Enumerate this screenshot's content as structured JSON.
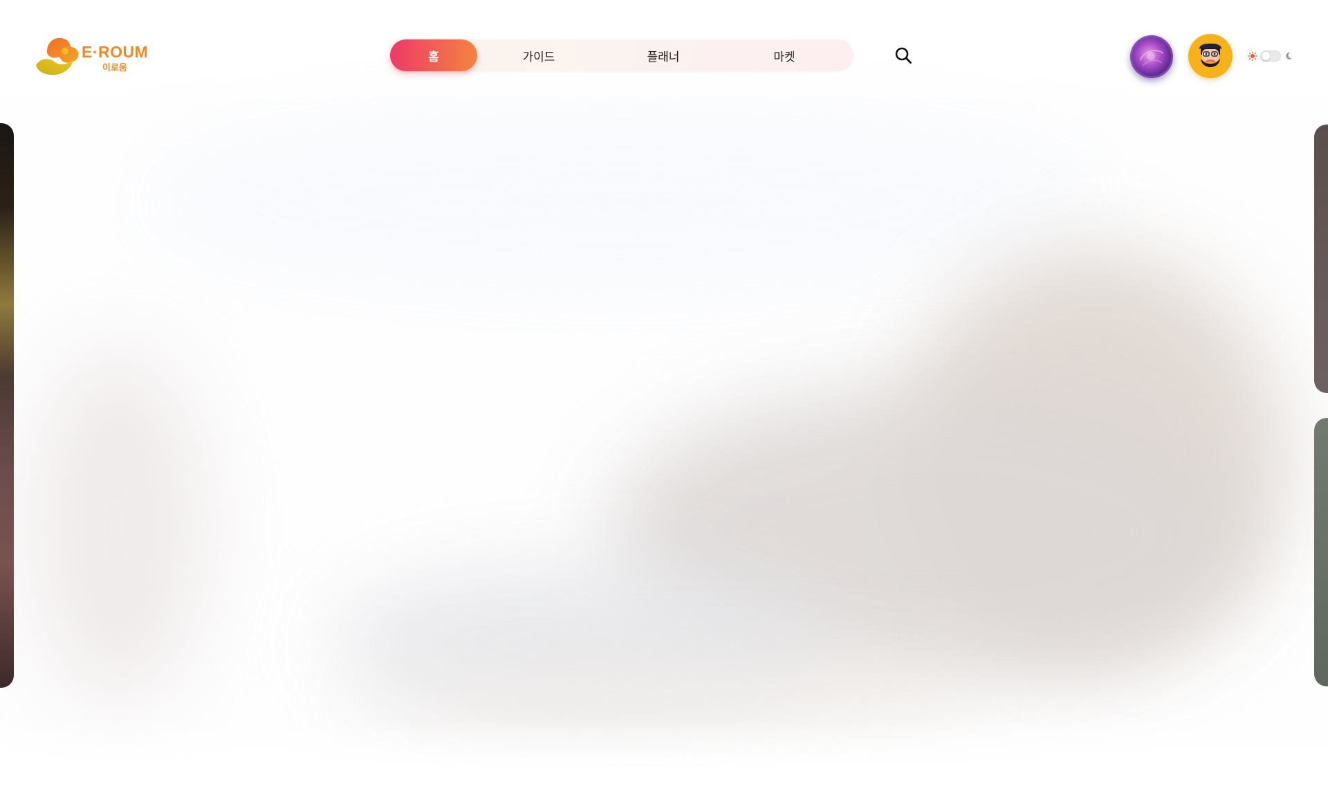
{
  "brand": {
    "name": "E·ROUM",
    "name_ko": "이로움",
    "colors": {
      "primary": "#f08a22",
      "accent_start": "#ee3a68",
      "accent_end": "#f5833f"
    }
  },
  "nav": {
    "tabs": [
      {
        "label": "홈",
        "active": true
      },
      {
        "label": "가이드",
        "active": false
      },
      {
        "label": "플래너",
        "active": false
      },
      {
        "label": "마켓",
        "active": false
      }
    ]
  },
  "header_actions": {
    "search_icon": "search-icon",
    "orb_icon": "purple-orb-icon",
    "avatar_icon": "bearded-man-avatar",
    "theme": {
      "sun_icon": "sun-icon",
      "moon_icon": "moon-icon",
      "dark_mode": false
    }
  }
}
